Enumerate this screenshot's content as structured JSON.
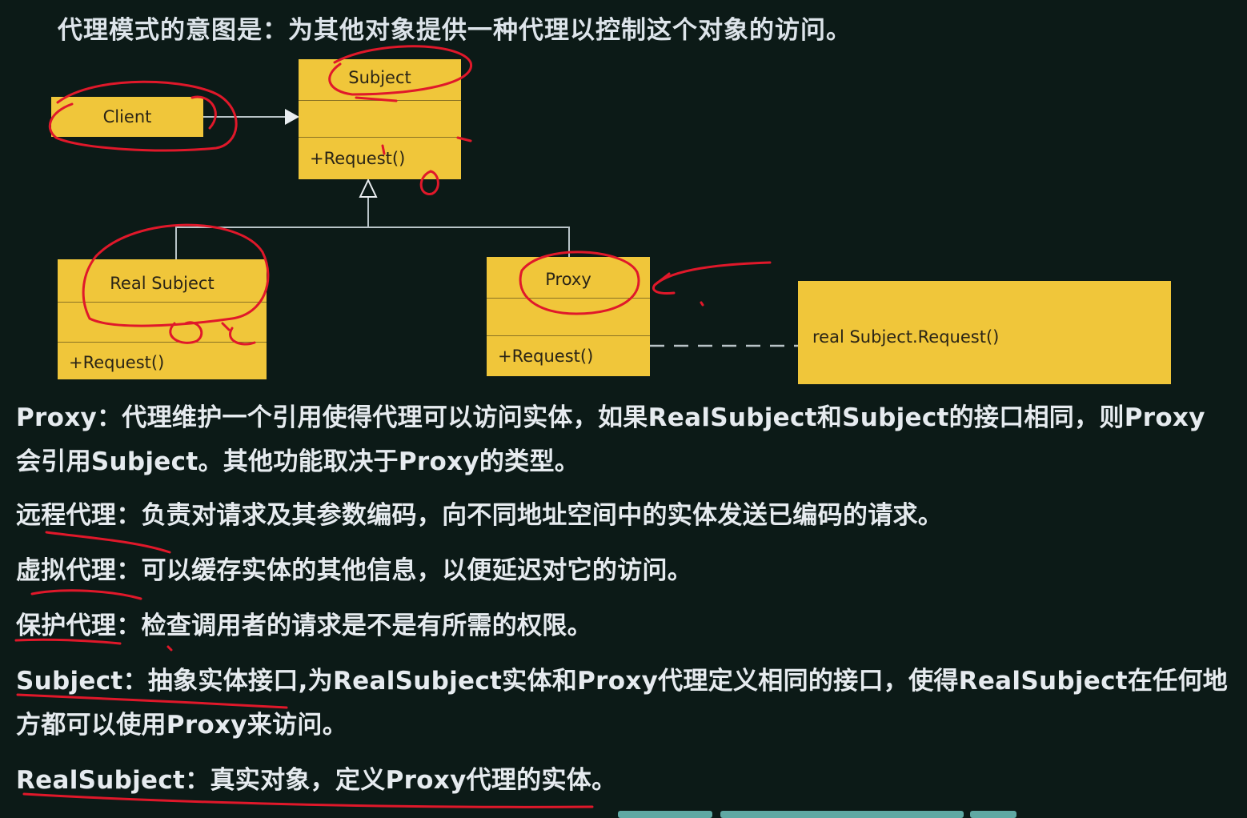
{
  "title": "代理模式的意图是：为其他对象提供一种代理以控制这个对象的访问。",
  "diagram": {
    "client": {
      "name": "Client"
    },
    "subject": {
      "name": "Subject",
      "operation": "+Request()"
    },
    "real_subject": {
      "name": "Real Subject",
      "operation": "+Request()"
    },
    "proxy": {
      "name": "Proxy",
      "operation": "+Request()"
    },
    "note": {
      "text": "real Subject.Request()"
    }
  },
  "paragraphs": {
    "proxy_line1": "Proxy：代理维护一个引用使得代理可以访问实体，如果RealSubject和Subject的接口相同，则Proxy",
    "proxy_line2": "会引用Subject。其他功能取决于Proxy的类型。",
    "remote": "远程代理：负责对请求及其参数编码，向不同地址空间中的实体发送已编码的请求。",
    "virtual": "虚拟代理：可以缓存实体的其他信息，以便延迟对它的访问。",
    "protection": "保护代理：检查调用者的请求是不是有所需的权限。",
    "subject_line1": "Subject：抽象实体接口,为RealSubject实体和Proxy代理定义相同的接口，使得RealSubject在任何地",
    "subject_line2": "方都可以使用Proxy来访问。",
    "realsubject": "RealSubject：真实对象，定义Proxy代理的实体。"
  },
  "colors": {
    "background": "#0c1a17",
    "box": "#f0c63a",
    "annotation": "#e0182a"
  }
}
